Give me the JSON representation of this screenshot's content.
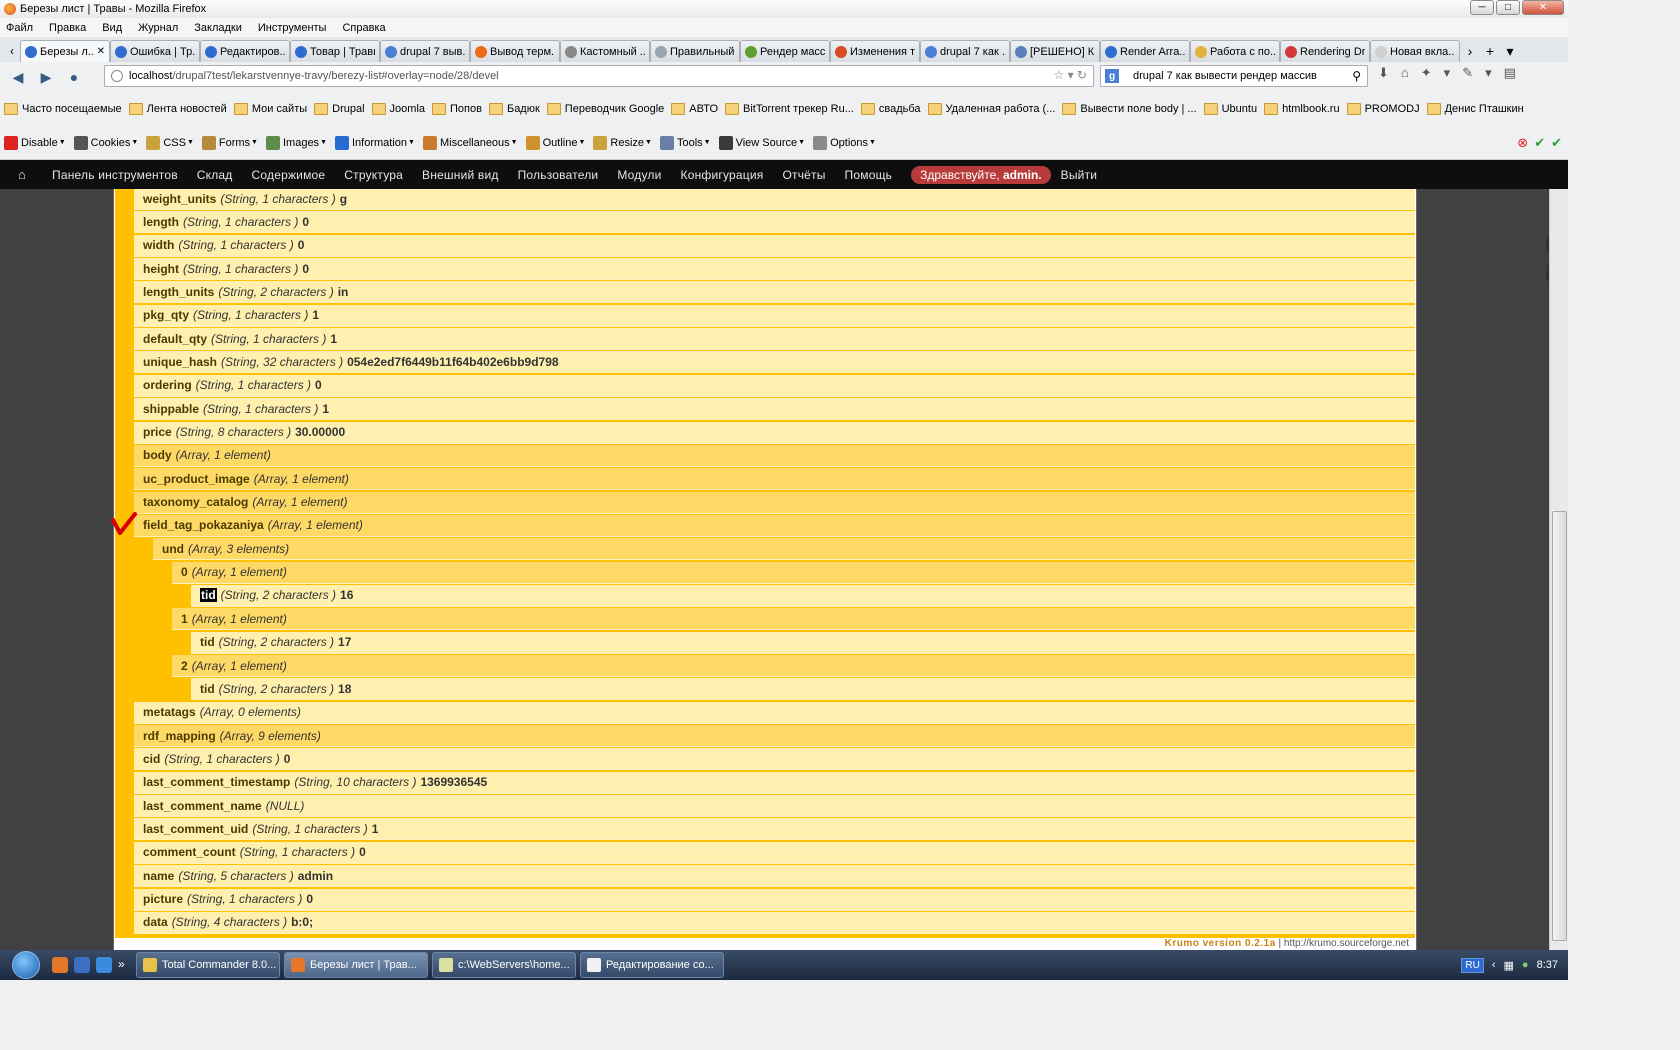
{
  "window": {
    "title": "Березы лист | Травы - Mozilla Firefox",
    "minimize": "─",
    "maximize": "□",
    "close": "✕"
  },
  "menu": [
    "Файл",
    "Правка",
    "Вид",
    "Журнал",
    "Закладки",
    "Инструменты",
    "Справка"
  ],
  "tabs": [
    {
      "label": "Березы л...",
      "color": "#2f6ccf",
      "active": true
    },
    {
      "label": "Ошибка | Тр...",
      "color": "#2f6ccf"
    },
    {
      "label": "Редактиров...",
      "color": "#2f6ccf"
    },
    {
      "label": "Товар | Травы",
      "color": "#2f6ccf"
    },
    {
      "label": "drupal 7 выв...",
      "color": "#4a7fd8"
    },
    {
      "label": "Вывод терм...",
      "color": "#f06a1a"
    },
    {
      "label": "Кастомный ...",
      "color": "#888888"
    },
    {
      "label": "Правильный...",
      "color": "#9aa4b0"
    },
    {
      "label": "Рендер масс...",
      "color": "#5ea02f"
    },
    {
      "label": "Изменения т...",
      "color": "#d94b22"
    },
    {
      "label": "drupal 7 как ...",
      "color": "#4a7fd8"
    },
    {
      "label": "[РЕШЕНО] К...",
      "color": "#5c7fb8"
    },
    {
      "label": "Render Arra...",
      "color": "#2f6ccf"
    },
    {
      "label": "Работа с по...",
      "color": "#e4b13b"
    },
    {
      "label": "Rendering Dr...",
      "color": "#d23a3a"
    },
    {
      "label": "Новая вкла...",
      "color": "#cfcfcf"
    }
  ],
  "nav": {
    "url_host": "localhost",
    "url_path": "/drupal7test/lekarstvennye-travy/berezy-list#overlay=node/28/devel",
    "search_value": "drupal 7 как вывести рендер массив"
  },
  "bookmarks": [
    "Часто посещаемые",
    "Лента новостей",
    "Мои сайты",
    "Drupal",
    "Joomla",
    "Попов",
    "Бадюк",
    "Переводчик Google",
    "АВТО",
    "BitTorrent трекер Ru...",
    "свадьба",
    "Удаленная работа (...",
    "Вывести поле body | ...",
    "Ubuntu",
    "htmlbook.ru",
    "PROMODJ",
    "Денис Пташкин"
  ],
  "devtools": [
    "Disable",
    "Cookies",
    "CSS",
    "Forms",
    "Images",
    "Information",
    "Miscellaneous",
    "Outline",
    "Resize",
    "Tools",
    "View Source",
    "Options"
  ],
  "admin": {
    "items": [
      "Панель инструментов",
      "Склад",
      "Содержимое",
      "Структура",
      "Внешний вид",
      "Пользователи",
      "Модули",
      "Конфигурация",
      "Отчёты",
      "Помощь"
    ],
    "hello_prefix": "Здравствуйте, ",
    "hello_user": "admin.",
    "logout": "Выйти"
  },
  "krumo": {
    "rows": [
      {
        "key": "weight_units",
        "type": "(String, 1 characters )",
        "value": "g",
        "kind": "str",
        "level": 0
      },
      {
        "key": "length",
        "type": "(String, 1 characters )",
        "value": "0",
        "kind": "str",
        "level": 0
      },
      {
        "key": "width",
        "type": "(String, 1 characters )",
        "value": "0",
        "kind": "str",
        "level": 0
      },
      {
        "key": "height",
        "type": "(String, 1 characters )",
        "value": "0",
        "kind": "str",
        "level": 0
      },
      {
        "key": "length_units",
        "type": "(String, 2 characters )",
        "value": "in",
        "kind": "str",
        "level": 0
      },
      {
        "key": "pkg_qty",
        "type": "(String, 1 characters )",
        "value": "1",
        "kind": "str",
        "level": 0
      },
      {
        "key": "default_qty",
        "type": "(String, 1 characters )",
        "value": "1",
        "kind": "str",
        "level": 0
      },
      {
        "key": "unique_hash",
        "type": "(String, 32 characters )",
        "value": "054e2ed7f6449b11f64b402e6bb9d798",
        "kind": "str",
        "level": 0
      },
      {
        "key": "ordering",
        "type": "(String, 1 characters )",
        "value": "0",
        "kind": "str",
        "level": 0
      },
      {
        "key": "shippable",
        "type": "(String, 1 characters )",
        "value": "1",
        "kind": "str",
        "level": 0
      },
      {
        "key": "price",
        "type": "(String, 8 characters )",
        "value": "30.00000",
        "kind": "str",
        "level": 0
      },
      {
        "key": "body",
        "type": "(Array, 1 element)",
        "value": "",
        "kind": "arr",
        "level": 0
      },
      {
        "key": "uc_product_image",
        "type": "(Array, 1 element)",
        "value": "",
        "kind": "arr",
        "level": 0
      },
      {
        "key": "taxonomy_catalog",
        "type": "(Array, 1 element)",
        "value": "",
        "kind": "arr",
        "level": 0
      },
      {
        "key": "field_tag_pokazaniya",
        "type": "(Array, 1 element)",
        "value": "",
        "kind": "arr",
        "level": 0
      },
      {
        "key": "und",
        "type": "(Array, 3 elements)",
        "value": "",
        "kind": "arr",
        "level": 1
      },
      {
        "key": "0",
        "type": "(Array, 1 element)",
        "value": "",
        "kind": "arr",
        "level": 2
      },
      {
        "key": "tid",
        "type": "(String, 2 characters )",
        "value": "16",
        "kind": "str",
        "level": 3,
        "selected": true
      },
      {
        "key": "1",
        "type": "(Array, 1 element)",
        "value": "",
        "kind": "arr",
        "level": 2
      },
      {
        "key": "tid",
        "type": "(String, 2 characters )",
        "value": "17",
        "kind": "str",
        "level": 3
      },
      {
        "key": "2",
        "type": "(Array, 1 element)",
        "value": "",
        "kind": "arr",
        "level": 2
      },
      {
        "key": "tid",
        "type": "(String, 2 characters )",
        "value": "18",
        "kind": "str",
        "level": 3
      },
      {
        "key": "metatags",
        "type": "(Array, 0 elements)",
        "value": "",
        "kind": "str",
        "level": 0
      },
      {
        "key": "rdf_mapping",
        "type": "(Array, 9 elements)",
        "value": "",
        "kind": "arr",
        "level": 0
      },
      {
        "key": "cid",
        "type": "(String, 1 characters )",
        "value": "0",
        "kind": "str",
        "level": 0
      },
      {
        "key": "last_comment_timestamp",
        "type": "(String, 10 characters )",
        "value": "1369936545",
        "kind": "str",
        "level": 0
      },
      {
        "key": "last_comment_name",
        "type": "(NULL)",
        "value": "",
        "kind": "str",
        "level": 0
      },
      {
        "key": "last_comment_uid",
        "type": "(String, 1 characters )",
        "value": "1",
        "kind": "str",
        "level": 0
      },
      {
        "key": "comment_count",
        "type": "(String, 1 characters )",
        "value": "0",
        "kind": "str",
        "level": 0
      },
      {
        "key": "name",
        "type": "(String, 5 characters )",
        "value": "admin",
        "kind": "str",
        "level": 0
      },
      {
        "key": "picture",
        "type": "(String, 1 characters )",
        "value": "0",
        "kind": "str",
        "level": 0
      },
      {
        "key": "data",
        "type": "(String, 4 characters )",
        "value": "b:0;",
        "kind": "str",
        "level": 0
      }
    ],
    "version": "Krumo version 0.2.1a",
    "site": "| http://krumo.sourceforge.net"
  },
  "taskbar": {
    "tasks": [
      {
        "label": "Total Commander 8.0...",
        "color": "#e8c24a"
      },
      {
        "label": "Березы лист | Трав...",
        "color": "#e5772b",
        "active": true
      },
      {
        "label": "c:\\WebServers\\home...",
        "color": "#d9e0a0"
      },
      {
        "label": "Редактирование со...",
        "color": "#f1f1f1"
      }
    ],
    "lang": "RU",
    "clock": "8:37"
  }
}
